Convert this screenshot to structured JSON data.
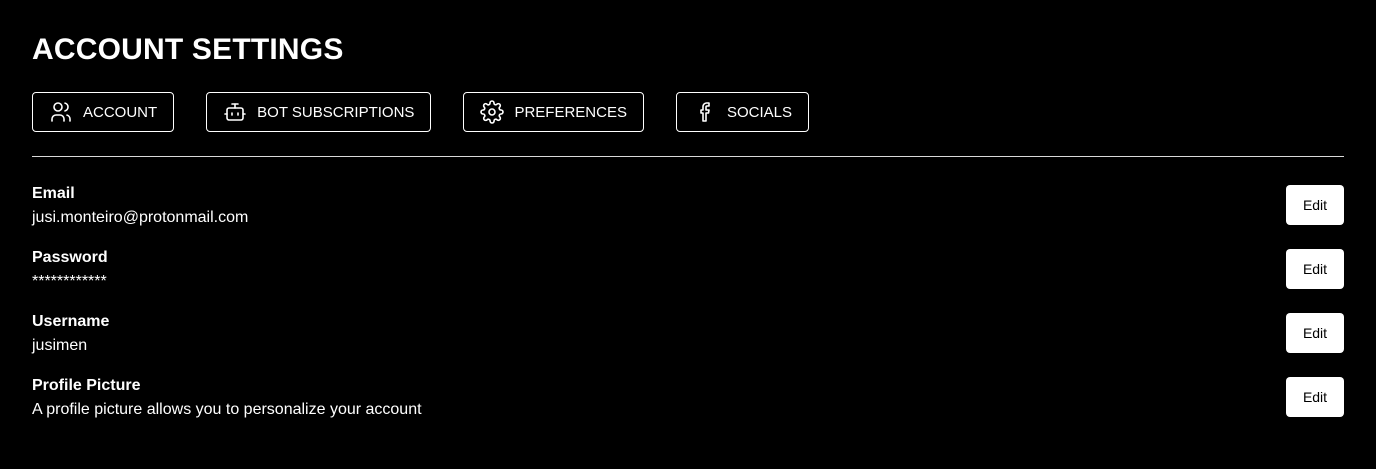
{
  "page": {
    "title": "ACCOUNT SETTINGS"
  },
  "tabs": [
    {
      "label": "ACCOUNT",
      "icon": "users-icon"
    },
    {
      "label": "BOT SUBSCRIPTIONS",
      "icon": "bot-icon"
    },
    {
      "label": "PREFERENCES",
      "icon": "gear-icon"
    },
    {
      "label": "SOCIALS",
      "icon": "facebook-icon"
    }
  ],
  "settings": [
    {
      "label": "Email",
      "value": "jusi.monteiro@protonmail.com",
      "button": "Edit"
    },
    {
      "label": "Password",
      "value": "************",
      "button": "Edit"
    },
    {
      "label": "Username",
      "value": "jusimen",
      "button": "Edit"
    },
    {
      "label": "Profile Picture",
      "value": "A profile picture allows you to personalize your account",
      "button": "Edit"
    }
  ],
  "colors": {
    "background": "#000000",
    "text": "#ffffff",
    "button_bg": "#ffffff",
    "button_text": "#000000"
  }
}
